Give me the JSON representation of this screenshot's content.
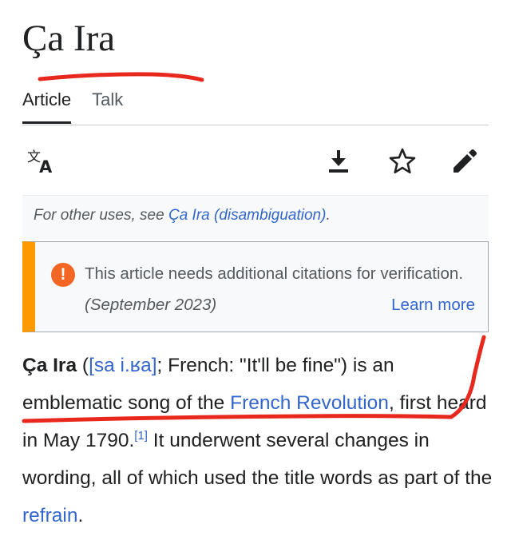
{
  "page": {
    "title": "Ça Ira"
  },
  "tabs": [
    {
      "label": "Article",
      "active": true
    },
    {
      "label": "Talk",
      "active": false
    }
  ],
  "toolbar": {
    "icons": [
      "translate-icon",
      "download-icon",
      "star-icon",
      "edit-pencil-icon"
    ]
  },
  "hatnote": {
    "prefix": "For other uses, see ",
    "link": "Ça Ira (disambiguation)",
    "suffix": "."
  },
  "notice": {
    "icon_text": "!",
    "text": "This article needs additional citations for verification.",
    "date": "(September 2023)",
    "learn_more": "Learn more"
  },
  "article": {
    "term": "Ça Ira",
    "open_paren": " (",
    "ipa_link": "[sa i.ʁa]",
    "after_ipa": "; French: \"It'll be fine\") is an emblematic song of the ",
    "link_revolution": "French Revolution",
    "after_revolution": ", first heard in May 1790.",
    "ref": "[1]",
    "after_ref": " It underwent several changes in wording, all of which used the title words as part of the ",
    "link_refrain": "refrain",
    "end": "."
  },
  "colors": {
    "link": "#3366cc",
    "notice_stripe": "#ff9900",
    "notice_icon": "#f26522",
    "annotation_ink": "#e8281c"
  }
}
